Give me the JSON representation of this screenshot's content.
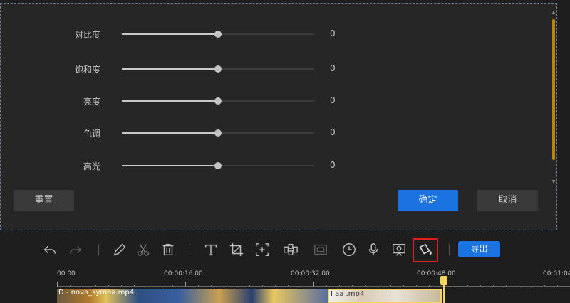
{
  "adjust": {
    "rows": [
      {
        "label": "对比度",
        "value": "0",
        "level": 0.5
      },
      {
        "label": "饱和度",
        "value": "0",
        "level": 0.5
      },
      {
        "label": "亮度",
        "value": "0",
        "level": 0.5
      },
      {
        "label": "色调",
        "value": "0",
        "level": 0.5
      },
      {
        "label": "高光",
        "value": "0",
        "level": 0.5
      }
    ],
    "reset_label": "重置",
    "confirm_label": "确定",
    "cancel_label": "取消"
  },
  "toolbar": {
    "icons": [
      "undo-icon",
      "redo-icon",
      "pencil-icon",
      "scissors-icon",
      "trash-icon",
      "text-icon",
      "crop-icon",
      "zoom-fit-icon",
      "mosaic-icon",
      "frame-icon",
      "clock-icon",
      "microphone-icon",
      "screen-record-icon",
      "paint-bucket-icon"
    ],
    "export_label": "导出"
  },
  "timeline": {
    "ticks": [
      "00.00",
      "00:00:16.00",
      "00:00:32.00",
      "00:00:48.00",
      "00:01:04"
    ],
    "clips": [
      {
        "name": "D - nova_symna.mp4"
      },
      {
        "name": "I  aa .mp4"
      }
    ]
  },
  "colors": {
    "accent": "#1a73e0",
    "highlight_box": "#e02020",
    "playhead": "#f2d55a",
    "scroll_thumb": "#b8860b"
  }
}
